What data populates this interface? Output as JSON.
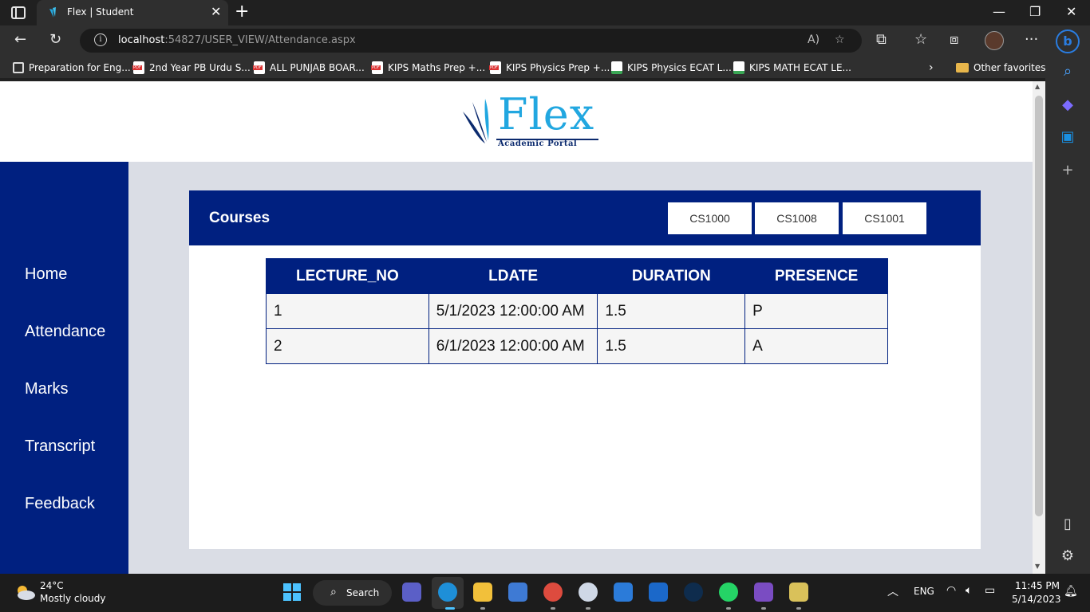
{
  "browser": {
    "tab_title": "Flex | Student",
    "address_host": "localhost",
    "address_rest": ":54827/USER_VIEW/Attendance.aspx",
    "favorites": [
      {
        "label": "Preparation for Eng...",
        "icon": "book-icon"
      },
      {
        "label": "2nd Year PB Urdu S...",
        "icon": "pdf-icon"
      },
      {
        "label": "ALL PUNJAB BOAR...",
        "icon": "pdf-icon"
      },
      {
        "label": "KIPS Maths Prep +...",
        "icon": "pdf-icon"
      },
      {
        "label": "KIPS Physics Prep +...",
        "icon": "pdf-icon"
      },
      {
        "label": "KIPS Physics ECAT L...",
        "icon": "doc-icon"
      },
      {
        "label": "KIPS MATH ECAT LE...",
        "icon": "doc-icon"
      }
    ],
    "other_favorites": "Other favorites"
  },
  "page": {
    "logo_text": "Flex",
    "logo_subtitle": "Academic Portal",
    "nav": [
      "Home",
      "Attendance",
      "Marks",
      "Transcript",
      "Feedback"
    ],
    "courses_title": "Courses",
    "courses": [
      "CS1000",
      "CS1008",
      "CS1001"
    ],
    "table": {
      "headers": [
        "LECTURE_NO",
        "LDATE",
        "DURATION",
        "PRESENCE"
      ],
      "rows": [
        [
          "1",
          "5/1/2023 12:00:00 AM",
          "1.5",
          "P"
        ],
        [
          "2",
          "6/1/2023 12:00:00 AM",
          "1.5",
          "A"
        ]
      ]
    },
    "colors": {
      "primary": "#002080",
      "logo": "#22a7e0",
      "background": "#dadde5"
    }
  },
  "taskbar": {
    "temperature": "24°C",
    "condition": "Mostly cloudy",
    "search_label": "Search",
    "language": "ENG",
    "time": "11:45 PM",
    "date": "5/14/2023"
  }
}
